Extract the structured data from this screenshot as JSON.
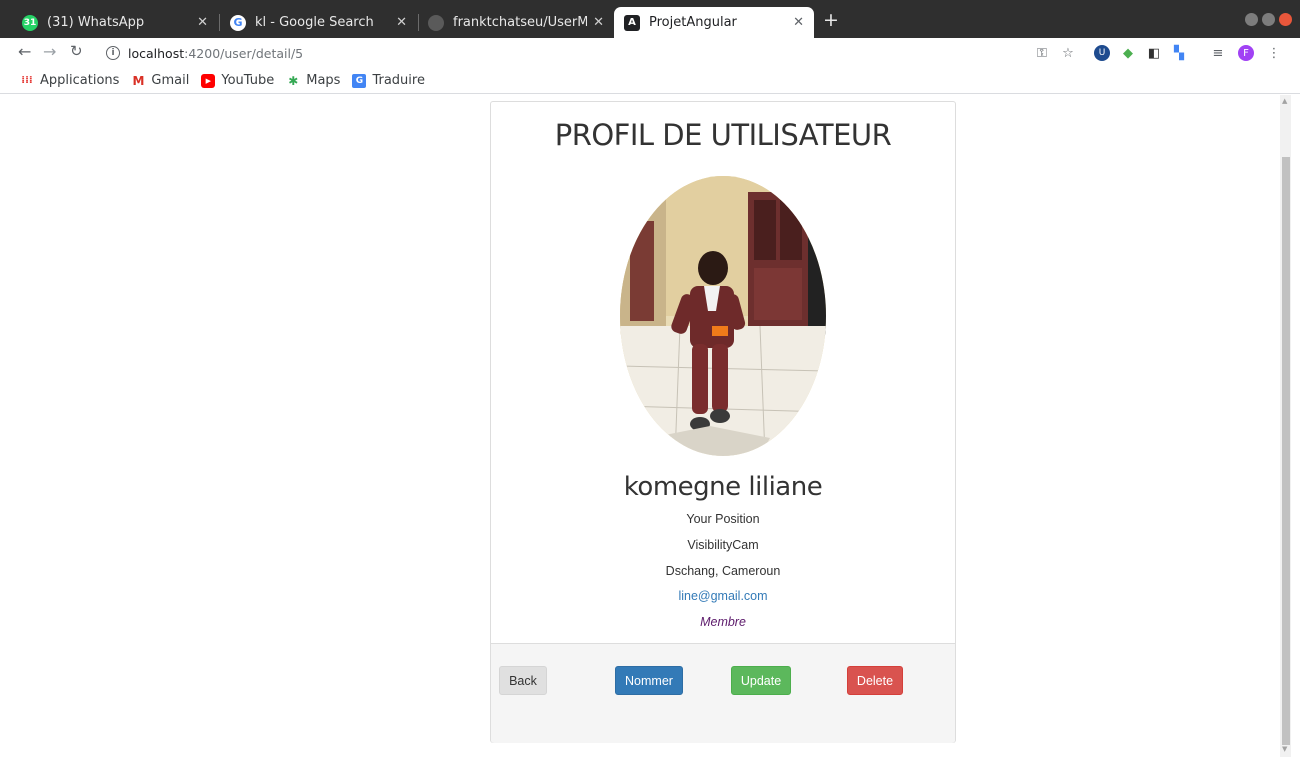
{
  "browser": {
    "tabs": [
      {
        "title": "(31) WhatsApp",
        "icon": "whatsapp-icon",
        "color": "#25d366",
        "active": false
      },
      {
        "title": "kl - Google Search",
        "icon": "google-icon",
        "color": "#4285f4",
        "active": false
      },
      {
        "title": "franktchatseu/UserMana",
        "icon": "github-icon",
        "color": "#3c3c3c",
        "active": false
      },
      {
        "title": "ProjetAngular",
        "icon": "angular-icon",
        "color": "#dd0031",
        "active": true
      }
    ],
    "tab_badge": "31",
    "address": {
      "host": "localhost",
      "path": ":4200/user/detail/5"
    },
    "profile_initial": "F",
    "bookmarks": [
      {
        "label": "Applications",
        "icon": "apps-grid-icon",
        "color": "#e53935"
      },
      {
        "label": "Gmail",
        "icon": "gmail-icon",
        "color": "#d93025"
      },
      {
        "label": "YouTube",
        "icon": "youtube-icon",
        "color": "#ff0000"
      },
      {
        "label": "Maps",
        "icon": "maps-icon",
        "color": "#34a853"
      },
      {
        "label": "Traduire",
        "icon": "translate-icon",
        "color": "#4285f4"
      }
    ]
  },
  "profile": {
    "heading": "PROFIL DE UTILISATEUR",
    "name": "komegne liliane",
    "position": "Your Position",
    "company": "VisibilityCam",
    "location": "Dschang, Cameroun",
    "email": "line@gmail.com",
    "role": "Membre"
  },
  "actions": {
    "back": "Back",
    "nommer": "Nommer",
    "update": "Update",
    "delete": "Delete"
  },
  "colors": {
    "primary": "#337ab7",
    "success": "#5cb85c",
    "danger": "#d9534f",
    "role_text": "#5c1a6b"
  }
}
